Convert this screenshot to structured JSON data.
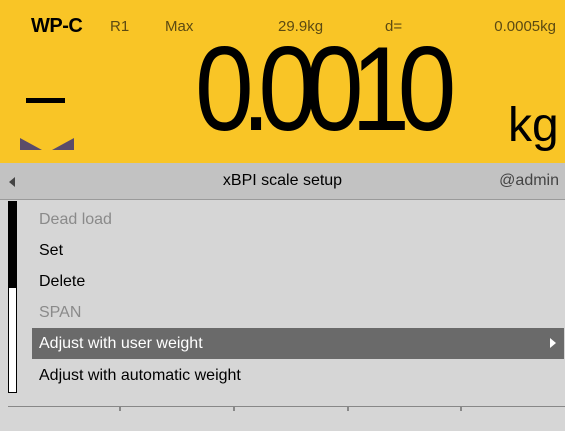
{
  "display": {
    "scale_name": "WP-C",
    "range": "R1",
    "max_label": "Max",
    "max_value": "29.9kg",
    "d_label": "d=",
    "d_value": "0.0005kg",
    "sign": "−",
    "weight": "0.0010",
    "unit": "kg",
    "stability_icon": "stability-indicator-icon"
  },
  "titlebar": {
    "back_icon": "back-arrow-icon",
    "title": "xBPI scale setup",
    "user": "@admin"
  },
  "menu": {
    "items": [
      {
        "label": "Dead load",
        "state": "disabled"
      },
      {
        "label": "Set",
        "state": "enabled"
      },
      {
        "label": "Delete",
        "state": "enabled"
      },
      {
        "label": "SPAN",
        "state": "disabled"
      },
      {
        "label": "Adjust with user weight",
        "state": "selected",
        "has_submenu": true
      },
      {
        "label": "Adjust with automatic weight",
        "state": "enabled"
      }
    ]
  },
  "colors": {
    "display_bg": "#f9c526",
    "screen_bg": "#d6d6d6",
    "selected_bg": "#6a6a6a",
    "disabled_text": "#8a8a8a"
  }
}
